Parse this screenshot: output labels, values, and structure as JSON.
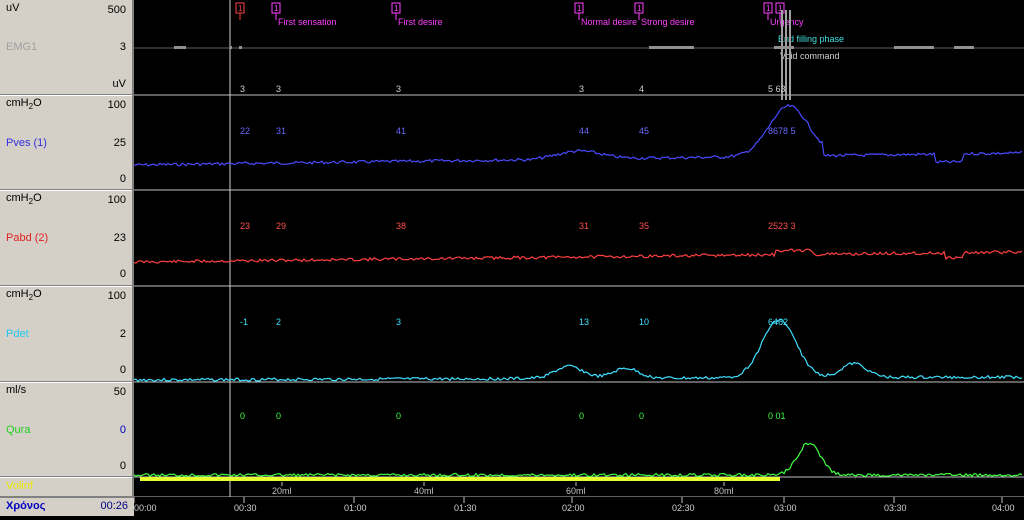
{
  "channels": [
    {
      "name": "EMG1",
      "unit": "uV",
      "unit_bottom": "uV",
      "max": "500",
      "mid": "3",
      "min": "",
      "color": "#c0c0c0"
    },
    {
      "name": "Pves (1)",
      "unit": "cmH2O",
      "max": "100",
      "mid": "25",
      "min": "0",
      "color": "#4a4aff"
    },
    {
      "name": "Pabd (2)",
      "unit": "cmH2O",
      "max": "100",
      "mid": "23",
      "min": "0",
      "color": "#ff4040"
    },
    {
      "name": "Pdet",
      "unit": "cmH2O",
      "max": "100",
      "mid": "2",
      "min": "0",
      "color": "#40e0ff"
    },
    {
      "name": "Qura",
      "unit": "ml/s",
      "max": "50",
      "mid": "0",
      "min": "0",
      "color": "#40ff40"
    },
    {
      "name": "Volinf",
      "unit": "",
      "max": "",
      "mid": "",
      "min": "",
      "color": "#ffff40"
    }
  ],
  "time_label": "Χρόνος",
  "time_value": "00:26",
  "time_ticks": [
    "00:00",
    "00:30",
    "01:00",
    "01:30",
    "02:00",
    "02:30",
    "03:00",
    "03:30",
    "04:00"
  ],
  "volume_ticks": [
    "20ml",
    "40ml",
    "60ml",
    "80ml"
  ],
  "events": [
    {
      "num": "1",
      "label": "",
      "color": "#ff4040"
    },
    {
      "num": "1",
      "label": "First sensation",
      "color": "#ff40ff"
    },
    {
      "num": "1",
      "label": "First desire",
      "color": "#ff40ff"
    },
    {
      "num": "1",
      "label": "Normal desire",
      "color": "#ff40ff"
    },
    {
      "num": "1",
      "label": "Strong desire",
      "color": "#ff40ff"
    },
    {
      "num": "1",
      "label": "Urgency",
      "color": "#ff40ff"
    },
    {
      "num": "1",
      "label": "",
      "color": "#ff40ff"
    }
  ],
  "phase_labels": [
    "End filling phase",
    "Void command"
  ],
  "readings": {
    "emg": [
      "3",
      "3",
      "3",
      "3",
      "4",
      "5 63"
    ],
    "pves": [
      "22",
      "31",
      "41",
      "44",
      "45",
      "8678 5"
    ],
    "pabd": [
      "23",
      "29",
      "38",
      "31",
      "35",
      "2523 3"
    ],
    "pdet": [
      "-1",
      "2",
      "3",
      "13",
      "10",
      "6462"
    ],
    "qura": [
      "0",
      "0",
      "0",
      "0",
      "0",
      "0 01"
    ]
  }
}
